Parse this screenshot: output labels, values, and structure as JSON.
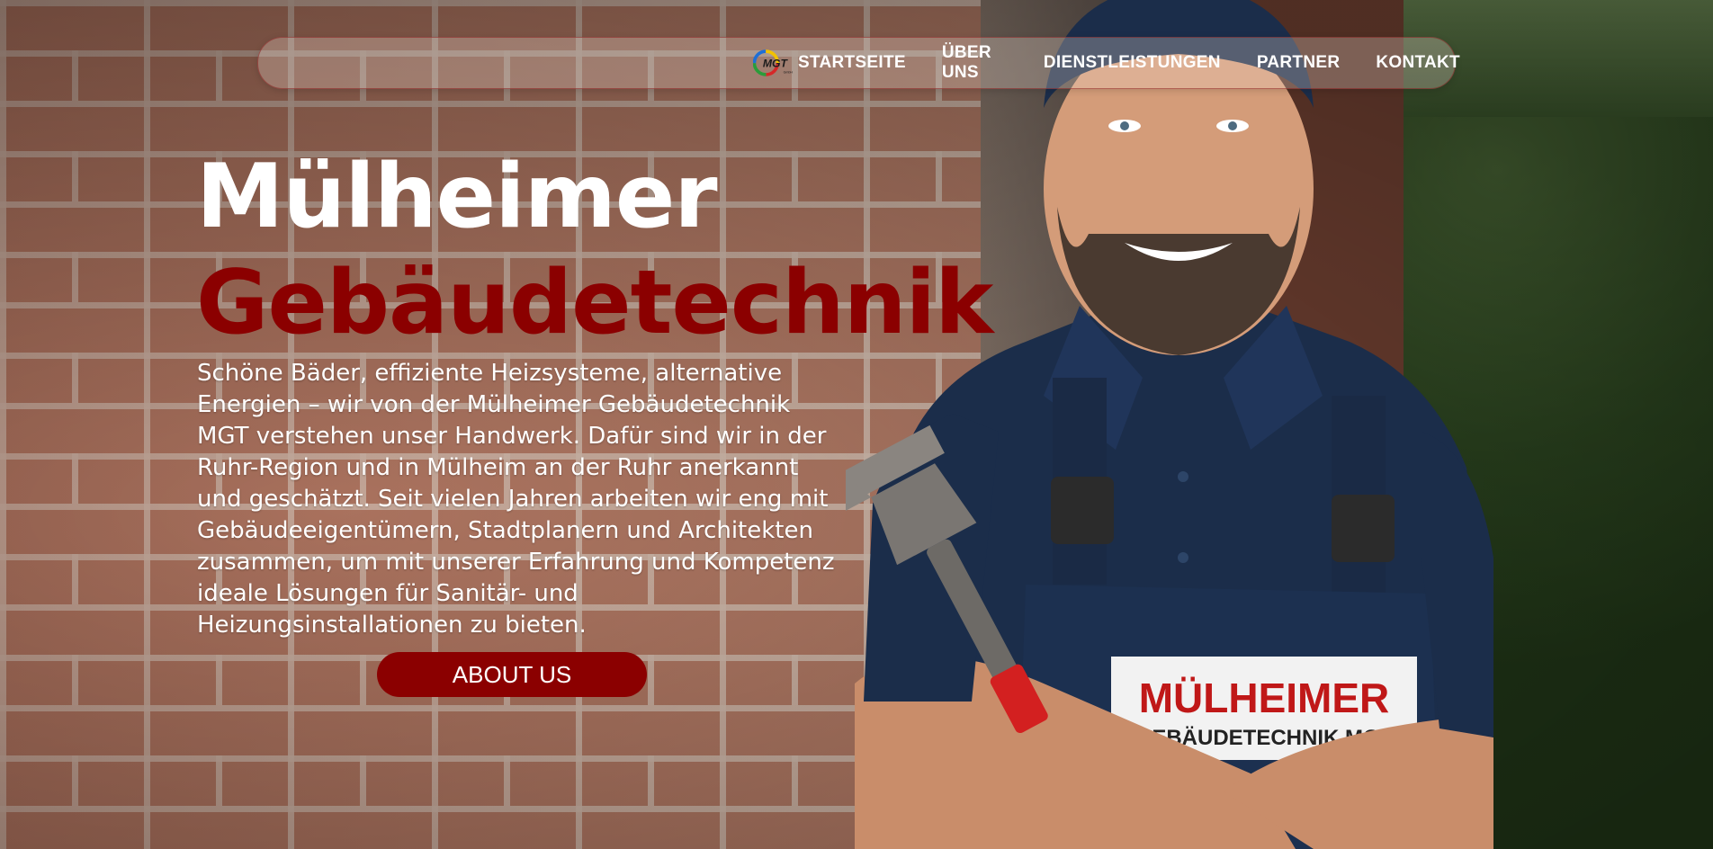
{
  "nav": {
    "logo_text": "MGT",
    "logo_subtext": "GmbH",
    "items": [
      {
        "label": "STARTSEITE"
      },
      {
        "label": "ÜBER UNS"
      },
      {
        "label": "DIENSTLEISTUNGEN"
      },
      {
        "label": "PARTNER"
      },
      {
        "label": "KONTAKT"
      }
    ]
  },
  "hero": {
    "title_line1": "Mülheimer",
    "title_line2": "Gebäudetechnik",
    "intro": "Schöne Bäder, effiziente Heizsysteme, alternative Energien – wir von der Mülheimer Gebäudetechnik MGT verstehen unser Handwerk. Dafür sind wir in der Ruhr-Region und in Mülheim an der Ruhr anerkannt und geschätzt. Seit vielen Jahren arbeiten wir eng mit Gebäudeeigentümern, Stadtplanern und Architekten zusammen, um mit unserer Erfahrung und Kompetenz ideale Lösungen für Sanitär- und Heizungsinstallationen zu bieten.",
    "button_label": "ABOUT US"
  },
  "photo": {
    "badge_line1": "MÜLHEIMER",
    "badge_line2": "GEBÄUDETECHNIK MGT"
  },
  "colors": {
    "accent": "#8b0000",
    "title_white": "#ffffff",
    "overall_navy": "#1b2d4a"
  }
}
